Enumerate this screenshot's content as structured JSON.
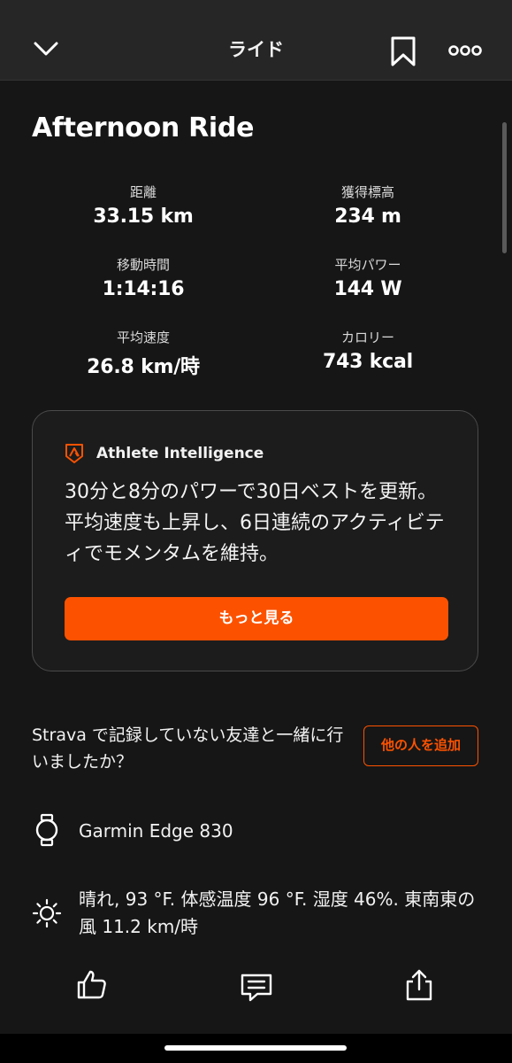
{
  "header": {
    "title": "ライド",
    "back_icon": "chevron-down-icon",
    "bookmark_icon": "bookmark-icon",
    "more_icon": "more-horizontal-icon"
  },
  "activity": {
    "title": "Afternoon Ride"
  },
  "stats": [
    {
      "label": "距離",
      "value": "33.15 km"
    },
    {
      "label": "獲得標高",
      "value": "234 m"
    },
    {
      "label": "移動時間",
      "value": "1:14:16"
    },
    {
      "label": "平均パワー",
      "value": "144 W"
    },
    {
      "label": "平均速度",
      "value": "26.8 km/時"
    },
    {
      "label": "カロリー",
      "value": "743 kcal"
    }
  ],
  "athlete_intelligence": {
    "label": "Athlete Intelligence",
    "summary": "30分と8分のパワーで30日ベストを更新。平均速度も上昇し、6日連続のアクティビティでモメンタムを維持。",
    "more_button": "もっと見る"
  },
  "friends": {
    "question": "Strava で記録していない友達と一緒に行いましたか？",
    "add_button": "他の人を追加"
  },
  "device": {
    "name": "Garmin Edge 830",
    "icon": "watch-icon"
  },
  "weather": {
    "text": "晴れ, 93 °F. 体感温度 96 °F. 湿度 46%. 東南東の風 11.2 km/時",
    "icon": "sun-icon"
  },
  "bottom_actions": {
    "like_icon": "thumbs-up-icon",
    "comment_icon": "comment-icon",
    "share_icon": "share-icon"
  },
  "colors": {
    "accent": "#fc5200",
    "background": "#161616",
    "header": "#262626"
  }
}
